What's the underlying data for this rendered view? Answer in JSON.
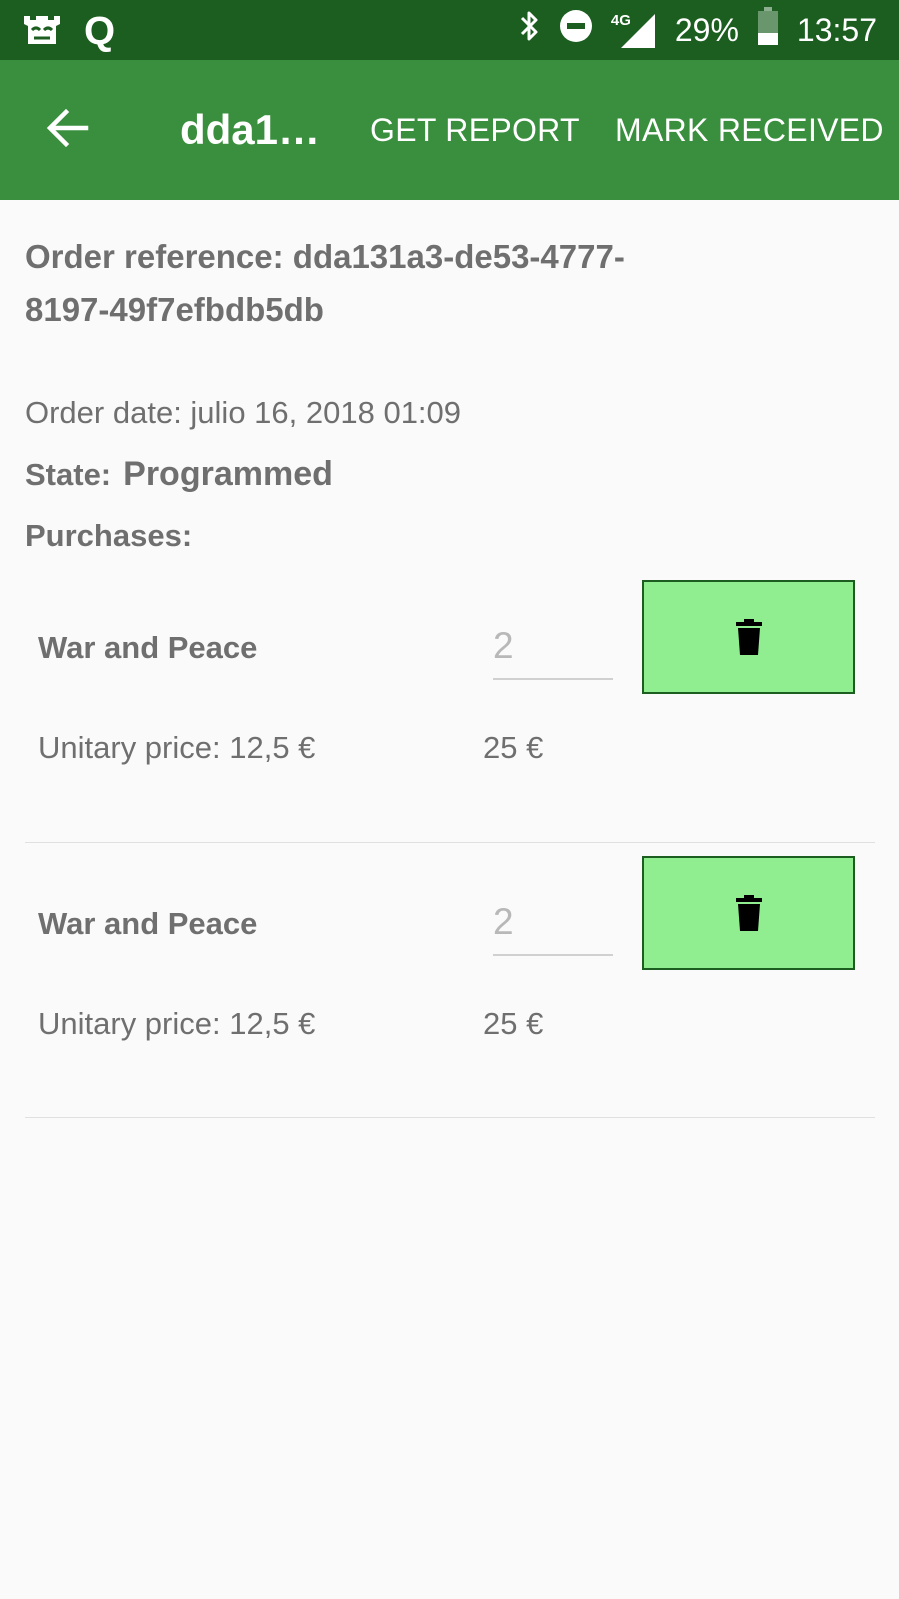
{
  "status_bar": {
    "app_icons": [
      "castle-icon",
      "q-icon"
    ],
    "q_label": "Q",
    "network": "4G",
    "battery": "29%",
    "time": "13:57"
  },
  "app_bar": {
    "title": "dda1…",
    "get_report": "GET REPORT",
    "mark_received": "MARK RECEIVED"
  },
  "order": {
    "reference": "Order reference: dda131a3-de53-4777-8197-49f7efbdb5db",
    "date": "Order date: julio 16, 2018 01:09",
    "state_label": "State:",
    "state_value": "Programmed",
    "purchases_label": "Purchases:"
  },
  "purchases": [
    {
      "name": "War and Peace",
      "quantity": "2",
      "unit_price": "Unitary price: 12,5 €",
      "total": "25 €"
    },
    {
      "name": "War and Peace",
      "quantity": "2",
      "unit_price": "Unitary price: 12,5 €",
      "total": "25 €"
    }
  ],
  "colors": {
    "status_bar": "#1b5e20",
    "app_bar": "#3a8f3e",
    "delete_button": "#90ee90",
    "delete_border": "#1b5e20",
    "text": "#6f6f6f"
  }
}
